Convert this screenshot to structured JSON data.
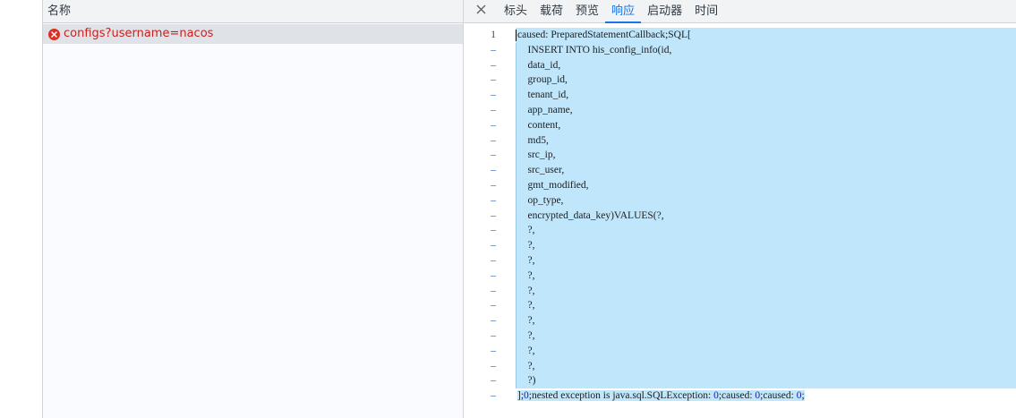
{
  "name_panel": {
    "header": "名称",
    "request": {
      "name": "configs?username=nacos",
      "status": "error"
    }
  },
  "detail_panel": {
    "close_icon": "close-icon",
    "tabs": [
      {
        "label": "标头",
        "active": false
      },
      {
        "label": "载荷",
        "active": false
      },
      {
        "label": "预览",
        "active": false
      },
      {
        "label": "响应",
        "active": true
      },
      {
        "label": "启动器",
        "active": false
      },
      {
        "label": "时间",
        "active": false
      }
    ],
    "response": {
      "first_line_number": "1",
      "continuation_marker": "–",
      "lines": [
        "caused: PreparedStatementCallback;SQL[",
        "    INSERT INTO his_config_info(id,",
        "    data_id,",
        "    group_id,",
        "    tenant_id,",
        "    app_name,",
        "    content,",
        "    md5,",
        "    src_ip,",
        "    src_user,",
        "    gmt_modified,",
        "    op_type,",
        "    encrypted_data_key)VALUES(?,",
        "    ?,",
        "    ?,",
        "    ?,",
        "    ?,",
        "    ?,",
        "    ?,",
        "    ?,",
        "    ?,",
        "    ?,",
        "    ?,",
        "    ?)"
      ],
      "last_line_parts": [
        {
          "text": "];",
          "kind": "text"
        },
        {
          "text": "0",
          "kind": "num"
        },
        {
          "text": ";nested exception is java.sql.SQLException: ",
          "kind": "text"
        },
        {
          "text": "0",
          "kind": "num"
        },
        {
          "text": ";caused: ",
          "kind": "text"
        },
        {
          "text": "0",
          "kind": "num"
        },
        {
          "text": ";caused: ",
          "kind": "text"
        },
        {
          "text": "0",
          "kind": "num"
        },
        {
          "text": ";",
          "kind": "text"
        }
      ]
    }
  },
  "colors": {
    "accent": "#1a73e8",
    "error": "#d93025",
    "selection": "#bfe6fb"
  }
}
